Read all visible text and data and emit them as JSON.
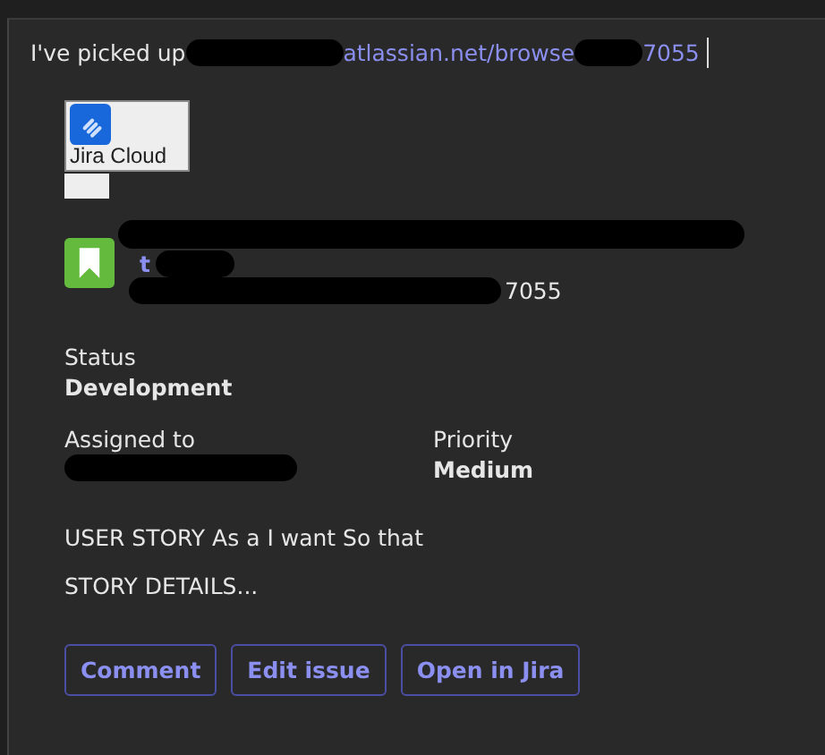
{
  "message": {
    "prefix": "I've picked up",
    "link_text": "atlassian.net/browse",
    "link_suffix": "7055"
  },
  "card": {
    "app_name": "Jira Cloud",
    "issue_title": "t",
    "issue_key": "7055",
    "fields": [
      {
        "label": "Status",
        "value": "Development"
      },
      {
        "label": "Assigned to"
      },
      {
        "label": "Priority",
        "value": "Medium"
      }
    ],
    "description": [
      "USER STORY As a  I want  So that",
      "STORY DETAILS..."
    ],
    "buttons": [
      "Comment",
      "Edit issue",
      "Open in Jira"
    ]
  }
}
